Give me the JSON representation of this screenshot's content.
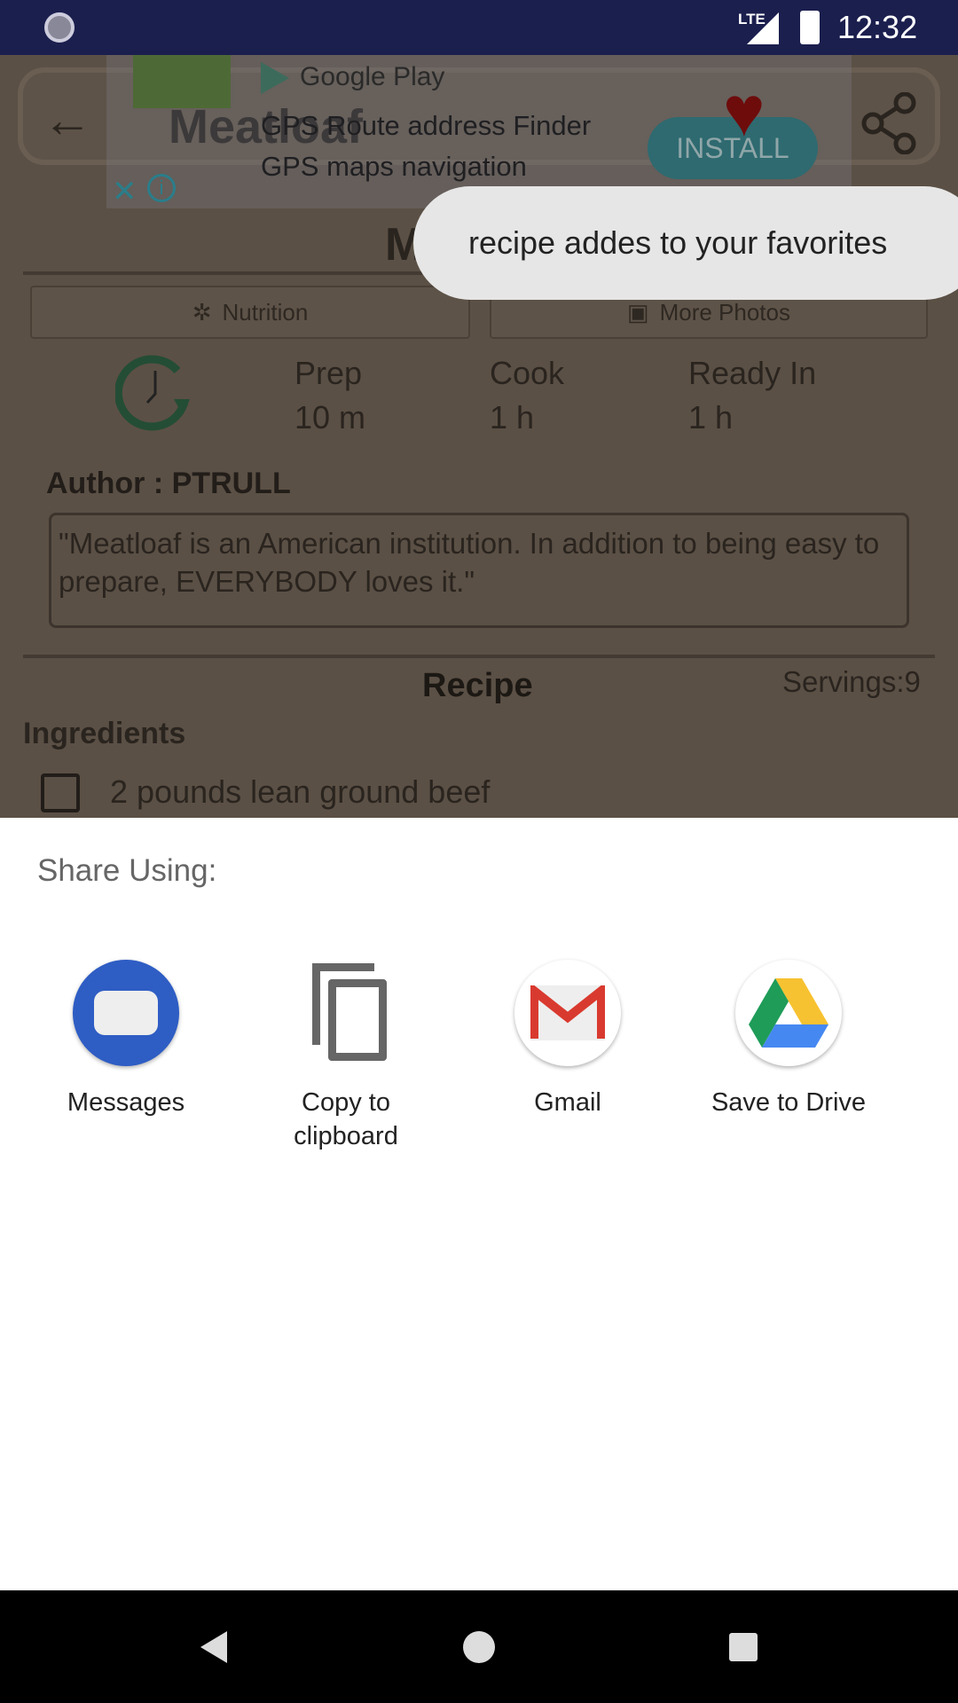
{
  "status_bar": {
    "time": "12:32",
    "network": "LTE"
  },
  "app_bar": {
    "title": "Meatloaf"
  },
  "ad": {
    "store": "Google Play",
    "line1": "GPS Route address Finder",
    "line2": "GPS maps navigation",
    "install": "INSTALL"
  },
  "toast": "recipe addes to your favorites",
  "recipe": {
    "heading": "Meatloaf",
    "nutrition": "Nutrition",
    "more_photos": "More Photos",
    "times": [
      {
        "label": "Prep",
        "value": "10 m"
      },
      {
        "label": "Cook",
        "value": "1 h"
      },
      {
        "label": "Ready In",
        "value": "1 h"
      }
    ],
    "author": "Author : PTRULL",
    "description": "\"Meatloaf is an American institution. In addition to being easy to prepare, EVERYBODY loves it.\"",
    "section": "Recipe",
    "servings": "Servings:9",
    "ingredients_title": "Ingredients",
    "ingredients": [
      "2 pounds lean ground beef"
    ]
  },
  "share": {
    "title": "Share Using:",
    "apps": [
      {
        "label": "Messages"
      },
      {
        "label": "Copy to clipboard"
      },
      {
        "label": "Gmail"
      },
      {
        "label": "Save to Drive"
      }
    ]
  }
}
